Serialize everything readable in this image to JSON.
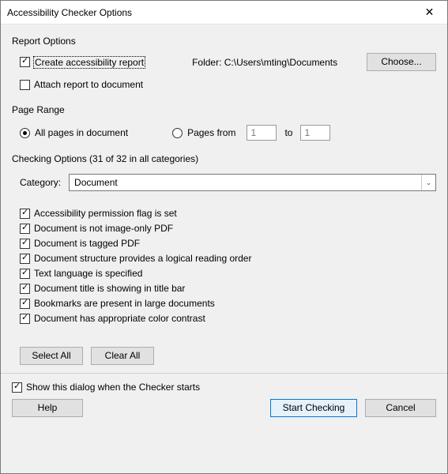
{
  "title": "Accessibility Checker Options",
  "reportOptions": {
    "label": "Report Options",
    "createReport": "Create accessibility report",
    "folderLabel": "Folder:  C:\\Users\\mting\\Documents",
    "choose": "Choose...",
    "attachReport": "Attach report to document"
  },
  "pageRange": {
    "label": "Page Range",
    "allPages": "All pages in document",
    "pagesFrom": "Pages from",
    "fromValue": "1",
    "toLabel": "to",
    "toValue": "1"
  },
  "checking": {
    "label": "Checking Options (31 of 32 in all categories)",
    "categoryLabel": "Category:",
    "categoryValue": "Document",
    "options": [
      "Accessibility permission flag is set",
      "Document is not image-only PDF",
      "Document is tagged PDF",
      "Document structure provides a logical reading order",
      "Text language is specified",
      "Document title is showing in title bar",
      "Bookmarks are present in large documents",
      "Document has appropriate color contrast"
    ],
    "selectAll": "Select All",
    "clearAll": "Clear All"
  },
  "showDialog": "Show this dialog when the Checker starts",
  "buttons": {
    "help": "Help",
    "start": "Start Checking",
    "cancel": "Cancel"
  }
}
